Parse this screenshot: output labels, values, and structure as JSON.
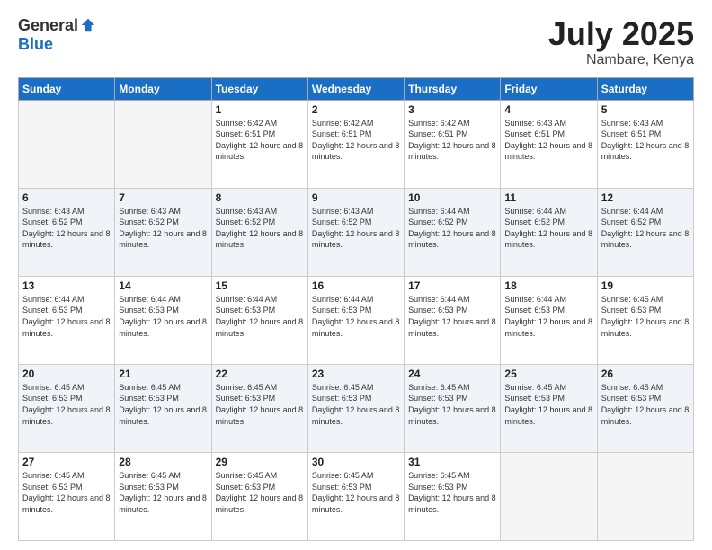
{
  "logo": {
    "general": "General",
    "blue": "Blue"
  },
  "title": {
    "month_year": "July 2025",
    "location": "Nambare, Kenya"
  },
  "days_of_week": [
    "Sunday",
    "Monday",
    "Tuesday",
    "Wednesday",
    "Thursday",
    "Friday",
    "Saturday"
  ],
  "weeks": [
    [
      {
        "day": "",
        "sunrise": "",
        "sunset": "",
        "daylight": "",
        "empty": true
      },
      {
        "day": "",
        "sunrise": "",
        "sunset": "",
        "daylight": "",
        "empty": true
      },
      {
        "day": "1",
        "sunrise": "Sunrise: 6:42 AM",
        "sunset": "Sunset: 6:51 PM",
        "daylight": "Daylight: 12 hours and 8 minutes.",
        "empty": false
      },
      {
        "day": "2",
        "sunrise": "Sunrise: 6:42 AM",
        "sunset": "Sunset: 6:51 PM",
        "daylight": "Daylight: 12 hours and 8 minutes.",
        "empty": false
      },
      {
        "day": "3",
        "sunrise": "Sunrise: 6:42 AM",
        "sunset": "Sunset: 6:51 PM",
        "daylight": "Daylight: 12 hours and 8 minutes.",
        "empty": false
      },
      {
        "day": "4",
        "sunrise": "Sunrise: 6:43 AM",
        "sunset": "Sunset: 6:51 PM",
        "daylight": "Daylight: 12 hours and 8 minutes.",
        "empty": false
      },
      {
        "day": "5",
        "sunrise": "Sunrise: 6:43 AM",
        "sunset": "Sunset: 6:51 PM",
        "daylight": "Daylight: 12 hours and 8 minutes.",
        "empty": false
      }
    ],
    [
      {
        "day": "6",
        "sunrise": "Sunrise: 6:43 AM",
        "sunset": "Sunset: 6:52 PM",
        "daylight": "Daylight: 12 hours and 8 minutes.",
        "empty": false
      },
      {
        "day": "7",
        "sunrise": "Sunrise: 6:43 AM",
        "sunset": "Sunset: 6:52 PM",
        "daylight": "Daylight: 12 hours and 8 minutes.",
        "empty": false
      },
      {
        "day": "8",
        "sunrise": "Sunrise: 6:43 AM",
        "sunset": "Sunset: 6:52 PM",
        "daylight": "Daylight: 12 hours and 8 minutes.",
        "empty": false
      },
      {
        "day": "9",
        "sunrise": "Sunrise: 6:43 AM",
        "sunset": "Sunset: 6:52 PM",
        "daylight": "Daylight: 12 hours and 8 minutes.",
        "empty": false
      },
      {
        "day": "10",
        "sunrise": "Sunrise: 6:44 AM",
        "sunset": "Sunset: 6:52 PM",
        "daylight": "Daylight: 12 hours and 8 minutes.",
        "empty": false
      },
      {
        "day": "11",
        "sunrise": "Sunrise: 6:44 AM",
        "sunset": "Sunset: 6:52 PM",
        "daylight": "Daylight: 12 hours and 8 minutes.",
        "empty": false
      },
      {
        "day": "12",
        "sunrise": "Sunrise: 6:44 AM",
        "sunset": "Sunset: 6:52 PM",
        "daylight": "Daylight: 12 hours and 8 minutes.",
        "empty": false
      }
    ],
    [
      {
        "day": "13",
        "sunrise": "Sunrise: 6:44 AM",
        "sunset": "Sunset: 6:53 PM",
        "daylight": "Daylight: 12 hours and 8 minutes.",
        "empty": false
      },
      {
        "day": "14",
        "sunrise": "Sunrise: 6:44 AM",
        "sunset": "Sunset: 6:53 PM",
        "daylight": "Daylight: 12 hours and 8 minutes.",
        "empty": false
      },
      {
        "day": "15",
        "sunrise": "Sunrise: 6:44 AM",
        "sunset": "Sunset: 6:53 PM",
        "daylight": "Daylight: 12 hours and 8 minutes.",
        "empty": false
      },
      {
        "day": "16",
        "sunrise": "Sunrise: 6:44 AM",
        "sunset": "Sunset: 6:53 PM",
        "daylight": "Daylight: 12 hours and 8 minutes.",
        "empty": false
      },
      {
        "day": "17",
        "sunrise": "Sunrise: 6:44 AM",
        "sunset": "Sunset: 6:53 PM",
        "daylight": "Daylight: 12 hours and 8 minutes.",
        "empty": false
      },
      {
        "day": "18",
        "sunrise": "Sunrise: 6:44 AM",
        "sunset": "Sunset: 6:53 PM",
        "daylight": "Daylight: 12 hours and 8 minutes.",
        "empty": false
      },
      {
        "day": "19",
        "sunrise": "Sunrise: 6:45 AM",
        "sunset": "Sunset: 6:53 PM",
        "daylight": "Daylight: 12 hours and 8 minutes.",
        "empty": false
      }
    ],
    [
      {
        "day": "20",
        "sunrise": "Sunrise: 6:45 AM",
        "sunset": "Sunset: 6:53 PM",
        "daylight": "Daylight: 12 hours and 8 minutes.",
        "empty": false
      },
      {
        "day": "21",
        "sunrise": "Sunrise: 6:45 AM",
        "sunset": "Sunset: 6:53 PM",
        "daylight": "Daylight: 12 hours and 8 minutes.",
        "empty": false
      },
      {
        "day": "22",
        "sunrise": "Sunrise: 6:45 AM",
        "sunset": "Sunset: 6:53 PM",
        "daylight": "Daylight: 12 hours and 8 minutes.",
        "empty": false
      },
      {
        "day": "23",
        "sunrise": "Sunrise: 6:45 AM",
        "sunset": "Sunset: 6:53 PM",
        "daylight": "Daylight: 12 hours and 8 minutes.",
        "empty": false
      },
      {
        "day": "24",
        "sunrise": "Sunrise: 6:45 AM",
        "sunset": "Sunset: 6:53 PM",
        "daylight": "Daylight: 12 hours and 8 minutes.",
        "empty": false
      },
      {
        "day": "25",
        "sunrise": "Sunrise: 6:45 AM",
        "sunset": "Sunset: 6:53 PM",
        "daylight": "Daylight: 12 hours and 8 minutes.",
        "empty": false
      },
      {
        "day": "26",
        "sunrise": "Sunrise: 6:45 AM",
        "sunset": "Sunset: 6:53 PM",
        "daylight": "Daylight: 12 hours and 8 minutes.",
        "empty": false
      }
    ],
    [
      {
        "day": "27",
        "sunrise": "Sunrise: 6:45 AM",
        "sunset": "Sunset: 6:53 PM",
        "daylight": "Daylight: 12 hours and 8 minutes.",
        "empty": false
      },
      {
        "day": "28",
        "sunrise": "Sunrise: 6:45 AM",
        "sunset": "Sunset: 6:53 PM",
        "daylight": "Daylight: 12 hours and 8 minutes.",
        "empty": false
      },
      {
        "day": "29",
        "sunrise": "Sunrise: 6:45 AM",
        "sunset": "Sunset: 6:53 PM",
        "daylight": "Daylight: 12 hours and 8 minutes.",
        "empty": false
      },
      {
        "day": "30",
        "sunrise": "Sunrise: 6:45 AM",
        "sunset": "Sunset: 6:53 PM",
        "daylight": "Daylight: 12 hours and 8 minutes.",
        "empty": false
      },
      {
        "day": "31",
        "sunrise": "Sunrise: 6:45 AM",
        "sunset": "Sunset: 6:53 PM",
        "daylight": "Daylight: 12 hours and 8 minutes.",
        "empty": false
      },
      {
        "day": "",
        "sunrise": "",
        "sunset": "",
        "daylight": "",
        "empty": true
      },
      {
        "day": "",
        "sunrise": "",
        "sunset": "",
        "daylight": "",
        "empty": true
      }
    ]
  ]
}
